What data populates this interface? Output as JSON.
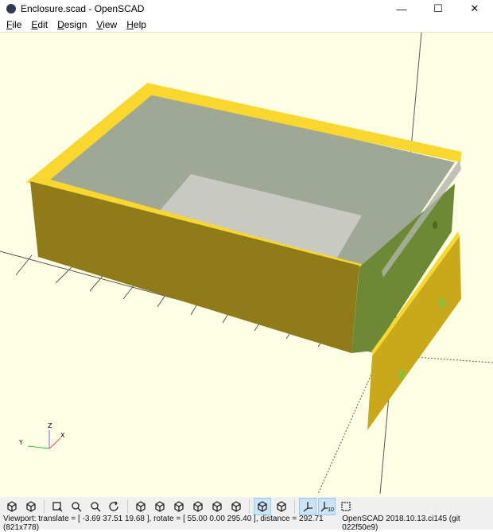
{
  "window": {
    "title": "Enclosure.scad - OpenSCAD",
    "minimize": "—",
    "maximize": "☐",
    "close": "✕"
  },
  "menu": [
    {
      "label": "File"
    },
    {
      "label": "Edit"
    },
    {
      "label": "Design"
    },
    {
      "label": "View"
    },
    {
      "label": "Help"
    }
  ],
  "viewport": {
    "background": "#ffffe5",
    "model_colors": {
      "rim": "#f9d72c",
      "front": "#8f7b18",
      "side": "#6b8a33",
      "interior": "#9fa795",
      "floor": "#c8c9c2",
      "plate": "#c9a81a"
    },
    "axis_labels": {
      "z": "Z",
      "y": "Y",
      "x": "X"
    }
  },
  "toolbar": [
    {
      "name": "preview",
      "icon": "preview-icon"
    },
    {
      "name": "render",
      "icon": "render-icon"
    },
    {
      "name": "view-all",
      "icon": "view-all-icon"
    },
    {
      "name": "zoom-in",
      "icon": "zoom-in-icon"
    },
    {
      "name": "zoom-out",
      "icon": "zoom-out-icon"
    },
    {
      "name": "reset-view",
      "icon": "reset-view-icon"
    },
    {
      "name": "view-right",
      "icon": "view-right-icon"
    },
    {
      "name": "view-top",
      "icon": "view-top-icon"
    },
    {
      "name": "view-bottom",
      "icon": "view-bottom-icon"
    },
    {
      "name": "view-left",
      "icon": "view-left-icon"
    },
    {
      "name": "view-front",
      "icon": "view-front-icon"
    },
    {
      "name": "view-back",
      "icon": "view-back-icon"
    },
    {
      "name": "perspective",
      "icon": "perspective-icon",
      "active": true
    },
    {
      "name": "orthogonal",
      "icon": "orthogonal-icon"
    },
    {
      "name": "show-axes",
      "icon": "axes-icon",
      "active": true
    },
    {
      "name": "show-scale-markers",
      "icon": "scale-markers-icon",
      "active": true,
      "label": "10"
    },
    {
      "name": "show-edges",
      "icon": "edges-icon"
    }
  ],
  "status": {
    "viewport": "Viewport: translate = [ -3.69 37.51 19.68 ], rotate = [ 55.00 0.00 295.40 ], distance = 292.71 (821x778)",
    "version": "OpenSCAD 2018.10.13.ci145 (git 022f50e9)"
  }
}
